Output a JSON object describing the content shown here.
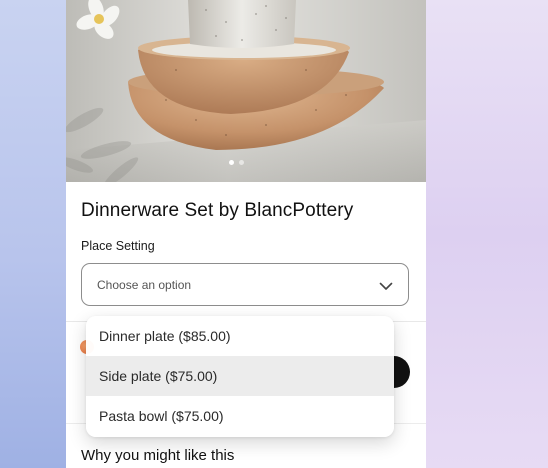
{
  "product": {
    "title": "Dinnerware Set by BlancPottery",
    "option_label": "Place Setting",
    "select_placeholder": "Choose an option",
    "image_dots": 2,
    "active_dot": 1
  },
  "dropdown": {
    "options": [
      {
        "label": "Dinner plate ($85.00)"
      },
      {
        "label": "Side plate ($75.00)"
      },
      {
        "label": "Pasta bowl ($75.00)"
      }
    ],
    "highlighted_index": 1
  },
  "recommendations": {
    "title": "Why you might like this"
  },
  "icons": {
    "select_chevron": "chevron-down-icon"
  },
  "colors": {
    "highlight": "#ececec",
    "link": "#3a7bd5"
  }
}
